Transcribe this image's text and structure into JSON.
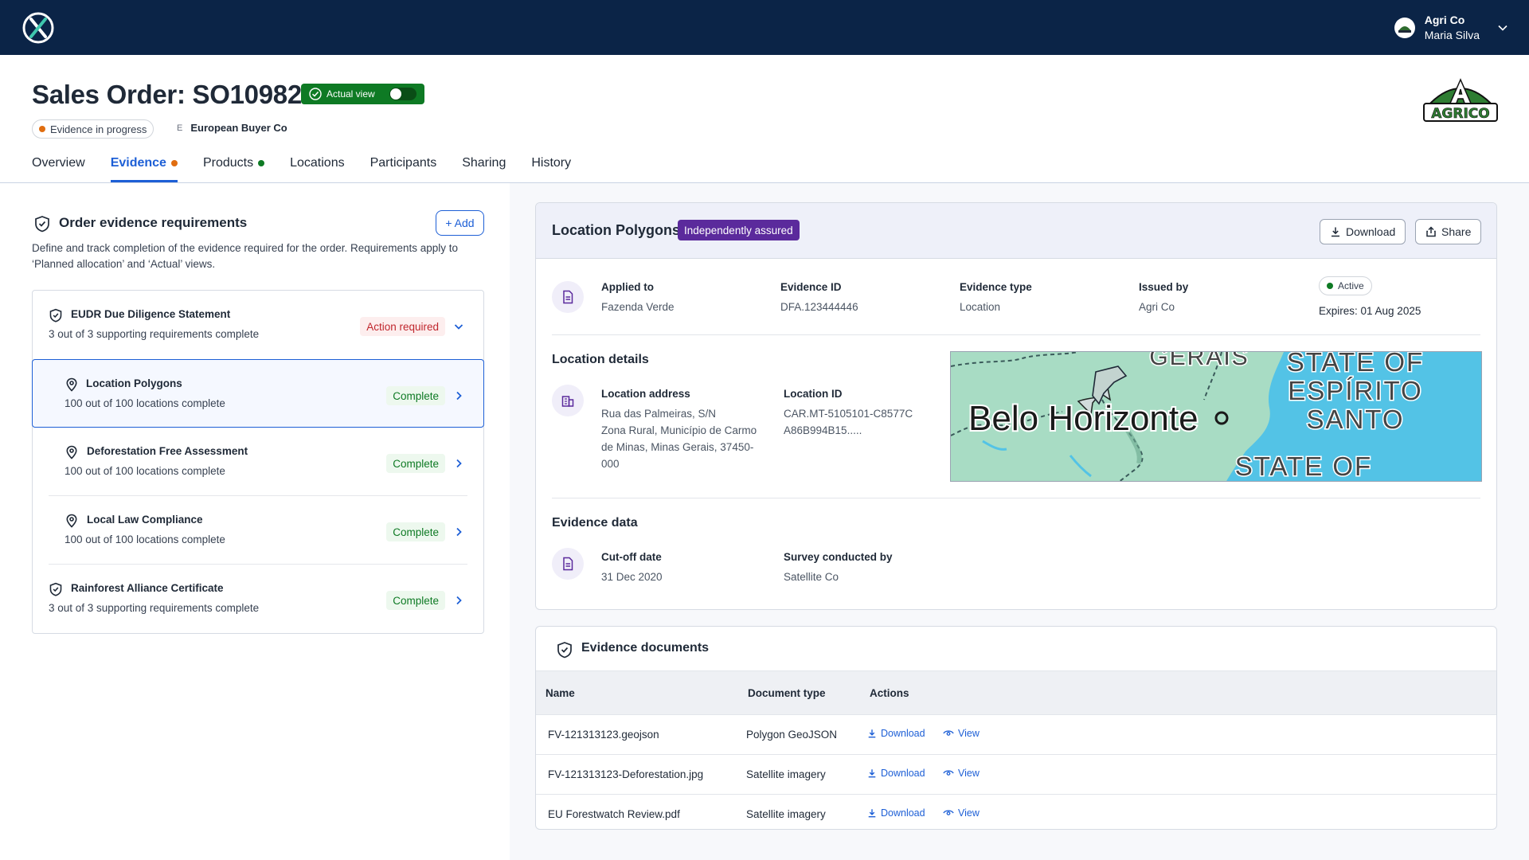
{
  "topbar": {
    "org": "Agri Co",
    "user": "Maria Silva"
  },
  "header": {
    "title": "Sales Order: SO10982",
    "view_toggle_label": "Actual view",
    "status": "Evidence in progress",
    "buyer_initial": "E",
    "buyer": "European Buyer Co",
    "logo_text_top": "A",
    "logo_text": "AGRICO"
  },
  "tabs": [
    {
      "label": "Overview"
    },
    {
      "label": "Evidence"
    },
    {
      "label": "Products"
    },
    {
      "label": "Locations"
    },
    {
      "label": "Participants"
    },
    {
      "label": "Sharing"
    },
    {
      "label": "History"
    }
  ],
  "colors": {
    "accent": "#1d5fd6",
    "nav": "#0b2447",
    "complete": "#0e7a24",
    "action": "#c0262d",
    "assured": "#5b2a9c",
    "in_progress_dot": "#e06d10"
  },
  "requirements_panel": {
    "title": "Order evidence requirements",
    "add_label": "+ Add",
    "description": "Define and track completion of the evidence required for the order. Requirements apply to ‘Planned allocation’ and ‘Actual’ views.",
    "items": [
      {
        "name": "EUDR Due Diligence Statement",
        "sub": "3 out of 3 supporting requirements complete",
        "status": "Action required",
        "icon": "shield-icon"
      },
      {
        "name": "Location Polygons",
        "sub": "100 out of 100 locations complete",
        "status": "Complete",
        "icon": "pin-icon"
      },
      {
        "name": "Deforestation Free Assessment",
        "sub": "100 out of 100 locations complete",
        "status": "Complete",
        "icon": "pin-icon"
      },
      {
        "name": "Local Law Compliance",
        "sub": "100 out of 100 locations complete",
        "status": "Complete",
        "icon": "pin-icon"
      },
      {
        "name": "Rainforest Alliance Certificate",
        "sub": "3 out of 3 supporting requirements complete",
        "status": "Complete",
        "icon": "shield-icon"
      }
    ]
  },
  "evidence": {
    "title": "Location Polygons",
    "badge": "Independently assured",
    "download_label": "Download",
    "share_label": "Share",
    "applied_to_label": "Applied to",
    "applied_to": "Fazenda Verde",
    "evidence_id_label": "Evidence ID",
    "evidence_id": "DFA.123444446",
    "evidence_type_label": "Evidence type",
    "evidence_type": "Location",
    "issued_by_label": "Issued by",
    "issued_by": "Agri Co",
    "state": "Active",
    "expires": "Expires: 01 Aug 2025",
    "location_details_title": "Location details",
    "location_address_label": "Location address",
    "location_address": "Rua das Palmeiras, S/N\n Zona Rural, Município de Carmo de Minas,  Minas Gerais, 37450-000",
    "location_id_label": "Location ID",
    "location_id": "CAR.MT-5105101-C8577CA86B994B15.....",
    "map_labels": {
      "city": "Belo Horizonte",
      "region_top": "GERAIS",
      "state_1": "STATE OF",
      "state_1b": "ESPÍRITO",
      "state_1c": "SANTO",
      "state_2": "STATE OF"
    },
    "evidence_data_title": "Evidence data",
    "cutoff_label": "Cut-off date",
    "cutoff": "31 Dec 2020",
    "survey_label": "Survey conducted by",
    "survey": "Satellite Co"
  },
  "documents": {
    "title": "Evidence documents",
    "columns": [
      "Name",
      "Document type",
      "Actions"
    ],
    "download_label": "Download",
    "view_label": "View",
    "rows": [
      {
        "name": "FV-121313123.geojson",
        "type": "Polygon GeoJSON"
      },
      {
        "name": "FV-121313123-Deforestation.jpg",
        "type": "Satellite imagery"
      },
      {
        "name": "EU Forestwatch Review.pdf",
        "type": "Satellite imagery"
      }
    ]
  }
}
